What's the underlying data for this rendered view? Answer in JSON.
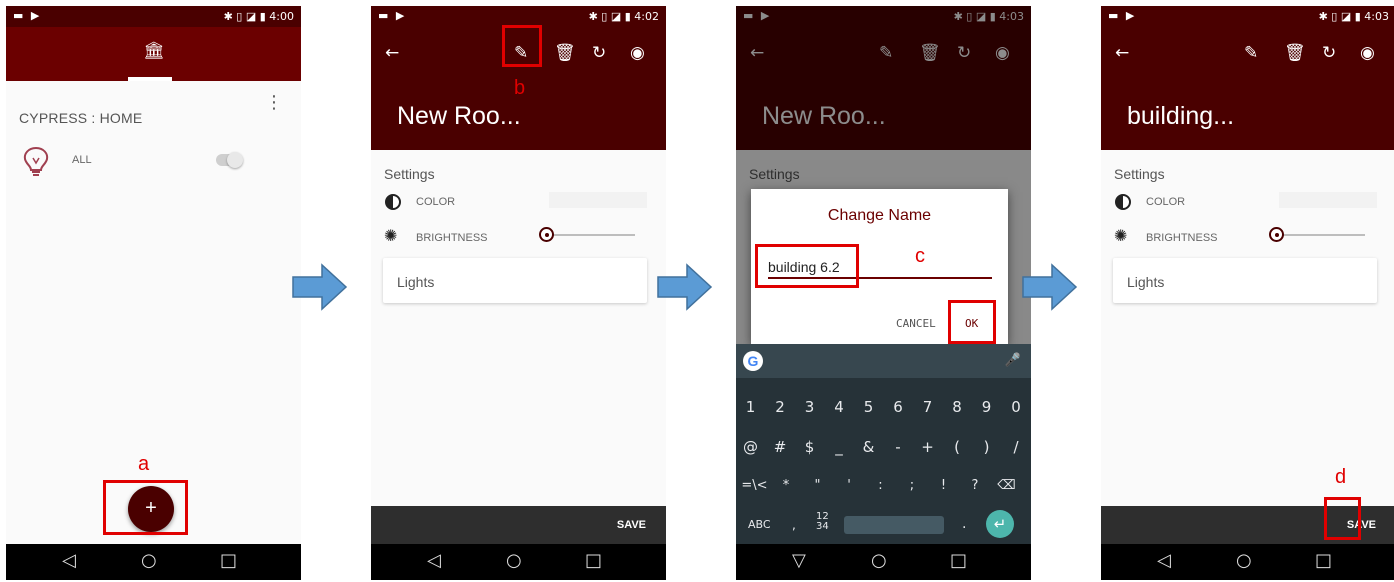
{
  "status": {
    "left_icons": "▬ ▶",
    "right_icons": "✱ ▯ ◪ ▮",
    "time_1": "4:00",
    "time_2": "4:02",
    "time_3": "4:03",
    "time_4": "4:03"
  },
  "screen1": {
    "title": "CYPRESS : HOME",
    "all_label": "ALL",
    "fab_label": "+"
  },
  "room": {
    "name_before": "New Roo...",
    "name_after": "building...",
    "settings_label": "Settings",
    "color_label": "COLOR",
    "brightness_label": "BRIGHTNESS",
    "lights_label": "Lights",
    "save_label": "SAVE"
  },
  "dialog": {
    "title": "Change Name",
    "input_value": "building 6.2",
    "cancel_label": "CANCEL",
    "ok_label": "OK"
  },
  "keyboard": {
    "row1": [
      "1",
      "2",
      "3",
      "4",
      "5",
      "6",
      "7",
      "8",
      "9",
      "0"
    ],
    "row2": [
      "@",
      "#",
      "$",
      "_",
      "&",
      "-",
      "+",
      "(",
      ")",
      "/"
    ],
    "row3": [
      "=\\<",
      "*",
      "\"",
      "'",
      ":",
      ";",
      "!",
      "?",
      "⌫"
    ],
    "abc_label": "ABC",
    "comma_label": ",",
    "numbers_label": "12\n34",
    "period_label": ".",
    "enter_label": "↵",
    "google_label": "G"
  },
  "annotations": {
    "a": "a",
    "b": "b",
    "c": "c",
    "d": "d"
  },
  "colors": {
    "header_dark": "#4a0000",
    "header_tab": "#6b0000",
    "annotation_red": "#e00000",
    "arrow_blue": "#5b9bd5"
  },
  "icons": {
    "home": "bank-icon",
    "edit": "pencil-icon",
    "delete": "trash-icon",
    "refresh": "refresh-icon",
    "target": "radio-target-icon",
    "back": "arrow-left-icon"
  }
}
